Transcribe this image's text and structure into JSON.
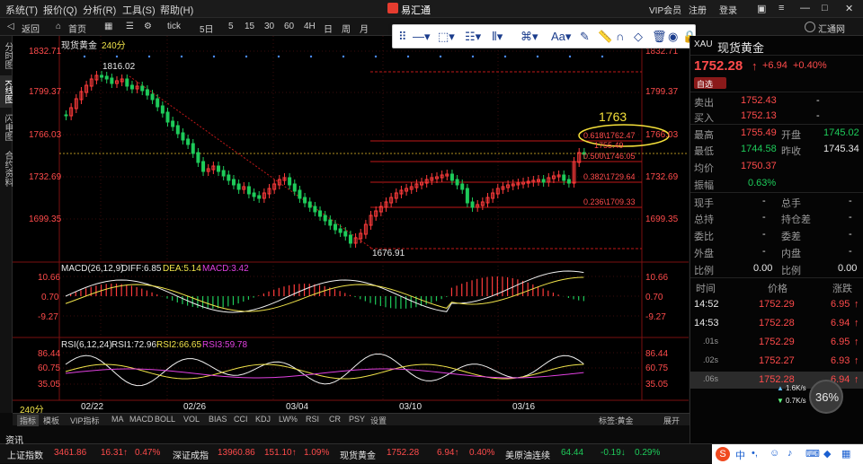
{
  "menubar": {
    "items": [
      "系统(T)",
      "报价(Q)",
      "分析(R)",
      "工具(S)",
      "帮助(H)"
    ],
    "app_title": "易汇通",
    "vip": "VIP会员",
    "register": "注册",
    "login": "登录"
  },
  "toolbar": {
    "back": "返回",
    "home": "首页",
    "buttons": [
      "tick",
      "5日",
      "5",
      "15",
      "30",
      "60",
      "4H",
      "日",
      "周",
      "月"
    ],
    "huitong": "汇通网"
  },
  "sidebar": {
    "tabs": [
      "分时图",
      "K线图",
      "闪电图",
      "合约资料"
    ]
  },
  "chart": {
    "title": "现货黄金",
    "period": "240分",
    "price_axis": [
      "1832.71",
      "1799.37",
      "1766.03",
      "1732.69",
      "1699.35"
    ],
    "high_label": "1816.02",
    "low_label": "1676.91",
    "fib_labels": [
      "0.618\\1762.47",
      "0.500\\1746.05",
      "0.382\\1729.64",
      "0.236\\1709.33"
    ],
    "callout": "1763",
    "last_label": "1755.49",
    "dates": [
      "02/22",
      "02/26",
      "03/04",
      "03/10",
      "03/16"
    ],
    "current_tag": "240分"
  },
  "macd": {
    "title": "MACD(26,12,9)",
    "diff": "DIFF:6.85",
    "dea": "DEA:5.14",
    "macd": "MACD:3.42",
    "axis": [
      "10.66",
      "0.70",
      "-9.27"
    ]
  },
  "rsi": {
    "title": "RSI(6,12,24)",
    "rsi1": "RSI1:72.96",
    "rsi2": "RSI2:66.65",
    "rsi3": "RSI3:59.78",
    "axis": [
      "86.44",
      "60.75",
      "35.05"
    ]
  },
  "bottom_tabs": [
    "指标",
    "模板",
    "VIP指标",
    "MA",
    "MACD",
    "BOLL",
    "VOL",
    "BIAS",
    "CCI",
    "KDJ",
    "LW%",
    "RSI",
    "CR",
    "PSY",
    "设置"
  ],
  "bottom_right": {
    "tag_label": "标签:黄金",
    "expand": "展开"
  },
  "quote": {
    "code": "XAU",
    "name": "现货黄金",
    "price": "1752.28",
    "arrow": "↑",
    "change": "+6.94",
    "change_pct": "+0.40%",
    "watch": "自选",
    "sell_label": "卖出",
    "sell": "1752.43",
    "sell_vol": "-",
    "buy_label": "买入",
    "buy": "1752.13",
    "buy_vol": "-",
    "high_label": "最高",
    "high": "1755.49",
    "open_label": "开盘",
    "open": "1745.02",
    "low_label": "最低",
    "low": "1744.58",
    "prev_label": "昨收",
    "prev": "1745.34",
    "avg_label": "均价",
    "avg": "1750.37",
    "amp_label": "振幅",
    "amp": "0.63%",
    "rows": [
      {
        "l": "现手",
        "v": "-",
        "l2": "总手",
        "v2": "-"
      },
      {
        "l": "总持",
        "v": "-",
        "l2": "持仓差",
        "v2": "-"
      },
      {
        "l": "委比",
        "v": "-",
        "l2": "委差",
        "v2": "-"
      },
      {
        "l": "外盘",
        "v": "-",
        "l2": "内盘",
        "v2": "-"
      },
      {
        "l": "比例",
        "v": "0.00",
        "l2": "比例",
        "v2": "0.00"
      }
    ],
    "tick_headers": [
      "时间",
      "价格",
      "涨跌"
    ],
    "ticks": [
      {
        "t": "14:52",
        "p": "1752.29",
        "c": "6.95"
      },
      {
        "t": "14:53",
        "p": "1752.28",
        "c": "6.94"
      },
      {
        "t": ".01s",
        "p": "1752.29",
        "c": "6.95"
      },
      {
        "t": ".02s",
        "p": "1752.27",
        "c": "6.93"
      },
      {
        "t": ".06s",
        "p": "1752.28",
        "c": "6.94"
      }
    ],
    "net_up": "1.6K/s",
    "net_down": "0.7K/s",
    "cpu": "36%"
  },
  "statusbar": {
    "info": "资讯",
    "items": [
      {
        "name": "上证指数",
        "val": "3461.86",
        "chg": "16.31↑",
        "pct": "0.47%"
      },
      {
        "name": "深证成指",
        "val": "13960.86",
        "chg": "151.10↑",
        "pct": "1.09%"
      },
      {
        "name": "现货黄金",
        "val": "1752.28",
        "chg": "6.94↑",
        "pct": "0.40%"
      },
      {
        "name": "美原油连续",
        "val": "64.44",
        "chg": "-0.19↓",
        "pct": "0.29%"
      }
    ]
  },
  "colors": {
    "up": "#ff4b4b",
    "down": "#1ecb5a",
    "diff": "#f0f0f0",
    "dea": "#f0e34a",
    "macd": "#e040e0",
    "fib": "#e02020",
    "callout": "#f5e03a"
  }
}
